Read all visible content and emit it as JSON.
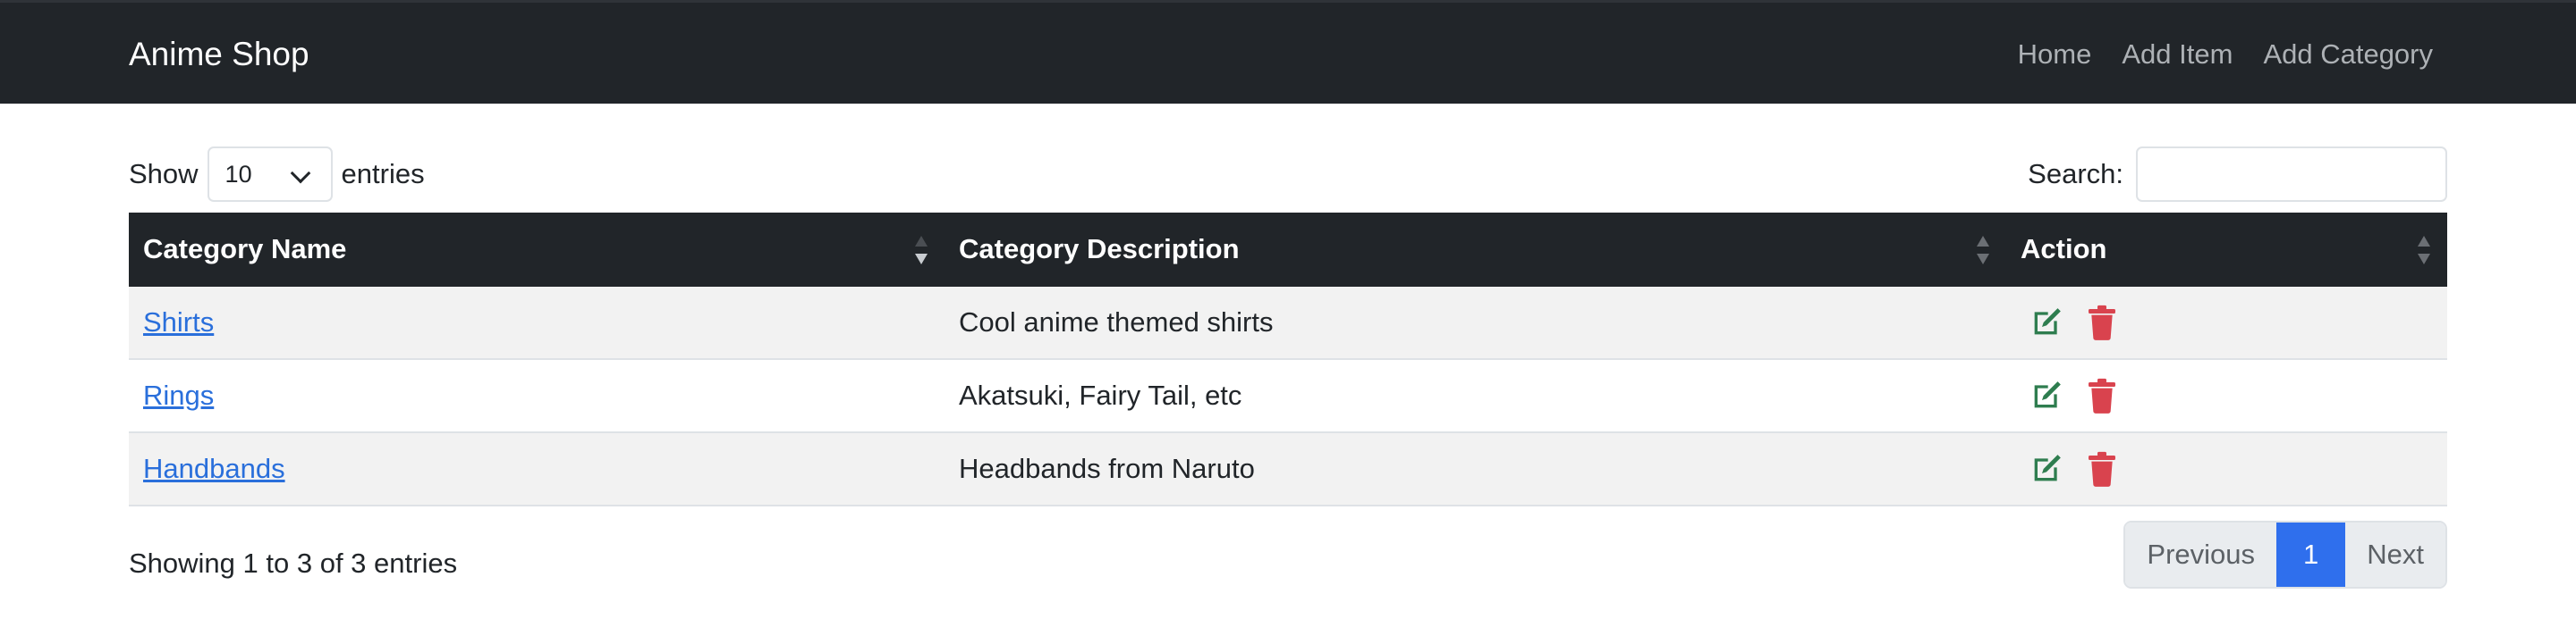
{
  "navbar": {
    "brand": "Anime Shop",
    "links": [
      "Home",
      "Add Item",
      "Add Category"
    ]
  },
  "length": {
    "prefix": "Show",
    "value": "10",
    "suffix": "entries"
  },
  "search": {
    "label": "Search:",
    "value": "",
    "placeholder": ""
  },
  "table": {
    "columns": [
      "Category Name",
      "Category Description",
      "Action"
    ],
    "rows": [
      {
        "name": "Shirts",
        "description": "Cool anime themed shirts"
      },
      {
        "name": "Rings",
        "description": "Akatsuki, Fairy Tail, etc"
      },
      {
        "name": "Handbands",
        "description": "Headbands from Naruto"
      }
    ]
  },
  "info": "Showing 1 to 3 of 3 entries",
  "pagination": {
    "previous": "Previous",
    "current": "1",
    "next": "Next"
  },
  "colors": {
    "navbar": "#212529",
    "link": "#2a6fdb",
    "edit": "#2e7d4f",
    "delete": "#d9434e",
    "page_active": "#2f6fed"
  },
  "icons": {
    "edit": "edit-icon",
    "delete": "trash-icon",
    "sort": "sort-icon"
  }
}
